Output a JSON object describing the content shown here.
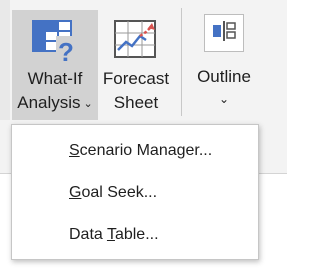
{
  "ribbon": {
    "what_if": {
      "line1": "What-If",
      "line2": "Analysis",
      "icon": "what-if-analysis-icon"
    },
    "forecast": {
      "line1": "Forecast",
      "line2": "Sheet",
      "icon": "forecast-sheet-icon"
    },
    "outline": {
      "line1": "Outline",
      "icon": "outline-icon"
    },
    "dropdown_glyph": "⌄"
  },
  "menu": {
    "items": [
      {
        "label": "Scenario Manager...",
        "accelerator": "S"
      },
      {
        "label": "Goal Seek...",
        "accelerator": "G"
      },
      {
        "label": "Data Table...",
        "accelerator": "T"
      }
    ]
  },
  "colors": {
    "ribbon_bg": "#f3f3f3",
    "pressed_bg": "#d2d2d2",
    "icon_blue": "#4472c4",
    "icon_red": "#d9534f"
  }
}
